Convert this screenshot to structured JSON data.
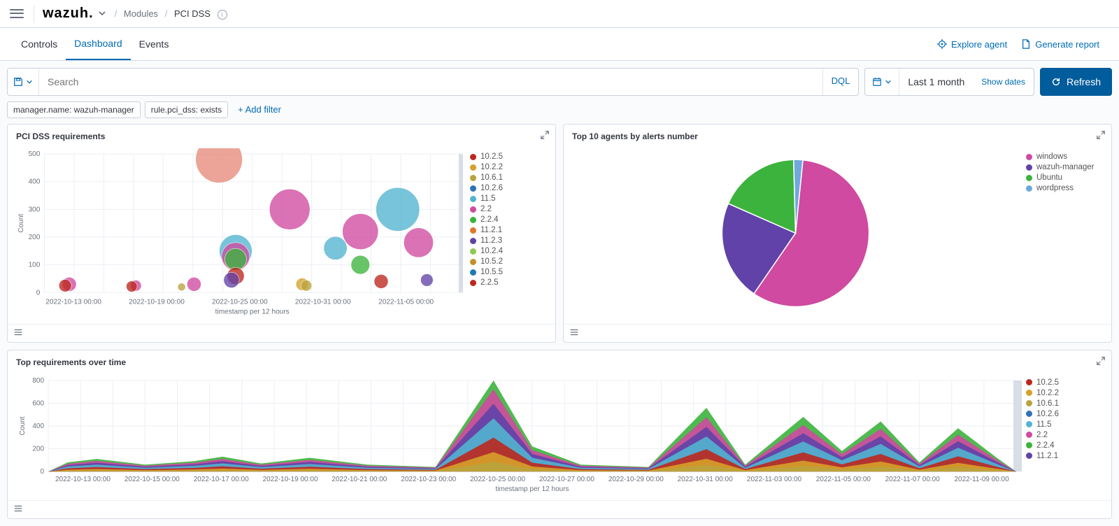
{
  "header": {
    "brand": "wazuh.",
    "crumb_parent": "Modules",
    "crumb_current": "PCI DSS"
  },
  "tabs": {
    "items": [
      "Controls",
      "Dashboard",
      "Events"
    ],
    "active_index": 1,
    "right": {
      "explore": "Explore agent",
      "report": "Generate report"
    }
  },
  "search": {
    "placeholder": "Search",
    "dql_label": "DQL"
  },
  "timepicker": {
    "range": "Last 1 month",
    "show_dates": "Show dates",
    "refresh": "Refresh"
  },
  "filters": {
    "pills": [
      "manager.name: wazuh-manager",
      "rule.pci_dss: exists"
    ],
    "add_label": "+ Add filter"
  },
  "panels": {
    "bubble": {
      "title": "PCI DSS requirements",
      "ylabel": "Count",
      "xlabel": "timestamp per 12 hours"
    },
    "pie": {
      "title": "Top 10 agents by alerts number"
    },
    "area": {
      "title": "Top requirements over time",
      "ylabel": "Count",
      "xlabel": "timestamp per 12 hours"
    }
  },
  "colors": {
    "accent": "#006bb4",
    "c1": "#bd271e",
    "c2": "#d6a02a",
    "c3": "#b9a33c",
    "c4": "#2e73b8",
    "c5": "#52b4cf",
    "c6": "#cf4aa0",
    "c7": "#3cb33c",
    "c8": "#e07628",
    "c9": "#6142a8",
    "c10": "#8fc951",
    "c11": "#c48f2c",
    "c12": "#1f7ab8"
  },
  "chart_data": [
    {
      "id": "bubble",
      "type": "scatter",
      "title": "PCI DSS requirements",
      "xlabel": "timestamp per 12 hours",
      "ylabel": "Count",
      "ylim": [
        0,
        500
      ],
      "x_ticks": [
        "2022-10-13 00:00",
        "2022-10-19 00:00",
        "2022-10-25 00:00",
        "2022-10-31 00:00",
        "2022-11-05 00:00"
      ],
      "legend": [
        "10.2.5",
        "10.2.2",
        "10.6.1",
        "10.2.6",
        "11.5",
        "2.2",
        "2.2.4",
        "11.2.1",
        "11.2.3",
        "10.2.4",
        "10.5.2",
        "10.5.5",
        "2.2.5"
      ],
      "legend_colors": [
        "#bd271e",
        "#d6a02a",
        "#b9a33c",
        "#2e73b8",
        "#52b4cf",
        "#cf4aa0",
        "#3cb33c",
        "#e07628",
        "#6142a8",
        "#8fc951",
        "#c48f2c",
        "#1f7ab8",
        "#bd271e"
      ],
      "points_note": "bubble size ~ count; approximated",
      "bubbles": [
        {
          "x": 0.06,
          "y": 30,
          "r": 18,
          "c": "#cf4aa0"
        },
        {
          "x": 0.05,
          "y": 25,
          "r": 16,
          "c": "#bd271e"
        },
        {
          "x": 0.22,
          "y": 25,
          "r": 14,
          "c": "#cf4aa0"
        },
        {
          "x": 0.21,
          "y": 22,
          "r": 14,
          "c": "#bd271e"
        },
        {
          "x": 0.33,
          "y": 20,
          "r": 10,
          "c": "#b9a33c"
        },
        {
          "x": 0.36,
          "y": 30,
          "r": 18,
          "c": "#cf4aa0"
        },
        {
          "x": 0.42,
          "y": 480,
          "r": 60,
          "c": "#e58b7a"
        },
        {
          "x": 0.46,
          "y": 150,
          "r": 42,
          "c": "#52b4cf"
        },
        {
          "x": 0.46,
          "y": 130,
          "r": 36,
          "c": "#cf4aa0"
        },
        {
          "x": 0.46,
          "y": 120,
          "r": 28,
          "c": "#3cb33c"
        },
        {
          "x": 0.46,
          "y": 60,
          "r": 22,
          "c": "#bd271e"
        },
        {
          "x": 0.45,
          "y": 45,
          "r": 20,
          "c": "#6142a8"
        },
        {
          "x": 0.59,
          "y": 300,
          "r": 52,
          "c": "#cf4aa0"
        },
        {
          "x": 0.62,
          "y": 30,
          "r": 16,
          "c": "#d6a02a"
        },
        {
          "x": 0.63,
          "y": 25,
          "r": 14,
          "c": "#b9a33c"
        },
        {
          "x": 0.7,
          "y": 160,
          "r": 30,
          "c": "#52b4cf"
        },
        {
          "x": 0.76,
          "y": 220,
          "r": 46,
          "c": "#cf4aa0"
        },
        {
          "x": 0.76,
          "y": 100,
          "r": 24,
          "c": "#3cb33c"
        },
        {
          "x": 0.85,
          "y": 300,
          "r": 56,
          "c": "#52b4cf"
        },
        {
          "x": 0.9,
          "y": 180,
          "r": 38,
          "c": "#cf4aa0"
        },
        {
          "x": 0.81,
          "y": 40,
          "r": 18,
          "c": "#bd271e"
        },
        {
          "x": 0.92,
          "y": 45,
          "r": 16,
          "c": "#6142a8"
        }
      ]
    },
    {
      "id": "pie",
      "type": "pie",
      "title": "Top 10 agents by alerts number",
      "series": [
        {
          "name": "windows",
          "value": 58,
          "color": "#cf4aa0"
        },
        {
          "name": "wazuh-manager",
          "value": 22,
          "color": "#6142a8"
        },
        {
          "name": "Ubuntu",
          "value": 18,
          "color": "#3cb33c"
        },
        {
          "name": "wordpress",
          "value": 2,
          "color": "#6fa8dc"
        }
      ]
    },
    {
      "id": "area",
      "type": "area",
      "title": "Top requirements over time",
      "xlabel": "timestamp per 12 hours",
      "ylabel": "Count",
      "ylim": [
        0,
        800
      ],
      "x_ticks": [
        "2022-10-13 00:00",
        "2022-10-15 00:00",
        "2022-10-17 00:00",
        "2022-10-19 00:00",
        "2022-10-21 00:00",
        "2022-10-23 00:00",
        "2022-10-25 00:00",
        "2022-10-27 00:00",
        "2022-10-29 00:00",
        "2022-10-31 00:00",
        "2022-11-03 00:00",
        "2022-11-05 00:00",
        "2022-11-07 00:00",
        "2022-11-09 00:00"
      ],
      "legend": [
        "10.2.5",
        "10.2.2",
        "10.6.1",
        "10.2.6",
        "11.5",
        "2.2",
        "2.2.4",
        "11.2.1"
      ],
      "legend_colors": [
        "#bd271e",
        "#d6a02a",
        "#b9a33c",
        "#2e73b8",
        "#52b4cf",
        "#cf4aa0",
        "#3cb33c",
        "#6142a8"
      ],
      "stacked_totals_approx": [
        {
          "x": 0.02,
          "y": 80
        },
        {
          "x": 0.05,
          "y": 110
        },
        {
          "x": 0.1,
          "y": 60
        },
        {
          "x": 0.15,
          "y": 90
        },
        {
          "x": 0.18,
          "y": 130
        },
        {
          "x": 0.22,
          "y": 70
        },
        {
          "x": 0.27,
          "y": 120
        },
        {
          "x": 0.33,
          "y": 60
        },
        {
          "x": 0.4,
          "y": 40
        },
        {
          "x": 0.46,
          "y": 850
        },
        {
          "x": 0.5,
          "y": 220
        },
        {
          "x": 0.55,
          "y": 60
        },
        {
          "x": 0.62,
          "y": 40
        },
        {
          "x": 0.68,
          "y": 560
        },
        {
          "x": 0.72,
          "y": 60
        },
        {
          "x": 0.78,
          "y": 480
        },
        {
          "x": 0.82,
          "y": 180
        },
        {
          "x": 0.86,
          "y": 440
        },
        {
          "x": 0.9,
          "y": 80
        },
        {
          "x": 0.94,
          "y": 380
        },
        {
          "x": 0.98,
          "y": 120
        }
      ]
    }
  ]
}
